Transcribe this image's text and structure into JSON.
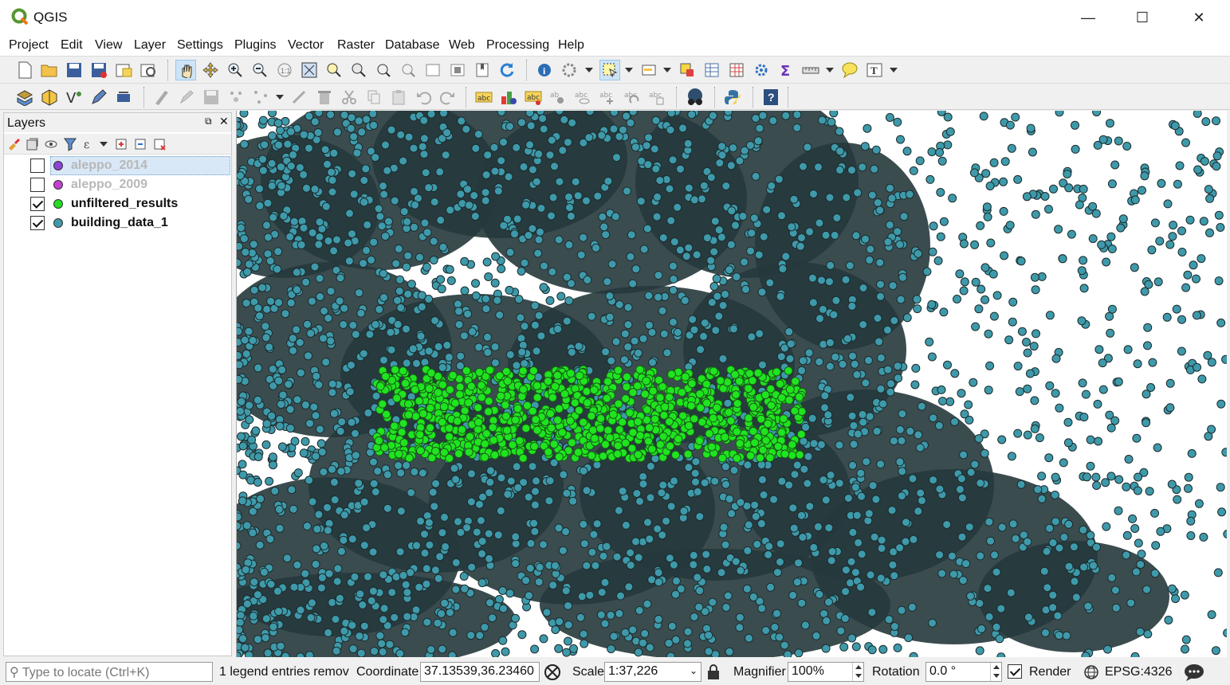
{
  "window": {
    "title": "QGIS",
    "minimize_icon": "minimize-icon",
    "maximize_icon": "maximize-icon",
    "close_icon": "close-icon"
  },
  "menubar": {
    "items": [
      {
        "label": "Project"
      },
      {
        "label": "Edit"
      },
      {
        "label": "View"
      },
      {
        "label": "Layer"
      },
      {
        "label": "Settings"
      },
      {
        "label": "Plugins"
      },
      {
        "label": "Vector"
      },
      {
        "label": "Raster"
      },
      {
        "label": "Database"
      },
      {
        "label": "Web"
      },
      {
        "label": "Processing"
      },
      {
        "label": "Help"
      }
    ]
  },
  "layers_panel": {
    "title": "Layers",
    "layers": [
      {
        "name": "aleppo_2014",
        "checked": false,
        "color": "#8e44d8",
        "selected": true
      },
      {
        "name": "aleppo_2009",
        "checked": false,
        "color": "#c33fd3",
        "selected": false
      },
      {
        "name": "unfiltered_results",
        "checked": true,
        "color": "#22dd22",
        "selected": false
      },
      {
        "name": "building_data_1",
        "checked": true,
        "color": "#3e9aaa",
        "selected": false
      }
    ]
  },
  "map": {
    "point_color": "#3e9aaa",
    "dense_color": "#26393c",
    "highlight_color": "#1fe41f"
  },
  "statusbar": {
    "locate_placeholder": "Type to locate (Ctrl+K)",
    "legend_message": "1 legend entries remov",
    "coordinate_label": "Coordinate",
    "coordinate_value": "37.13539,36.23460",
    "scale_label": "Scale",
    "scale_value": "1:37,226",
    "magnifier_label": "Magnifier",
    "magnifier_value": "100%",
    "rotation_label": "Rotation",
    "rotation_value": "0.0 °",
    "render_label": "Render",
    "crs_label": "EPSG:4326"
  }
}
